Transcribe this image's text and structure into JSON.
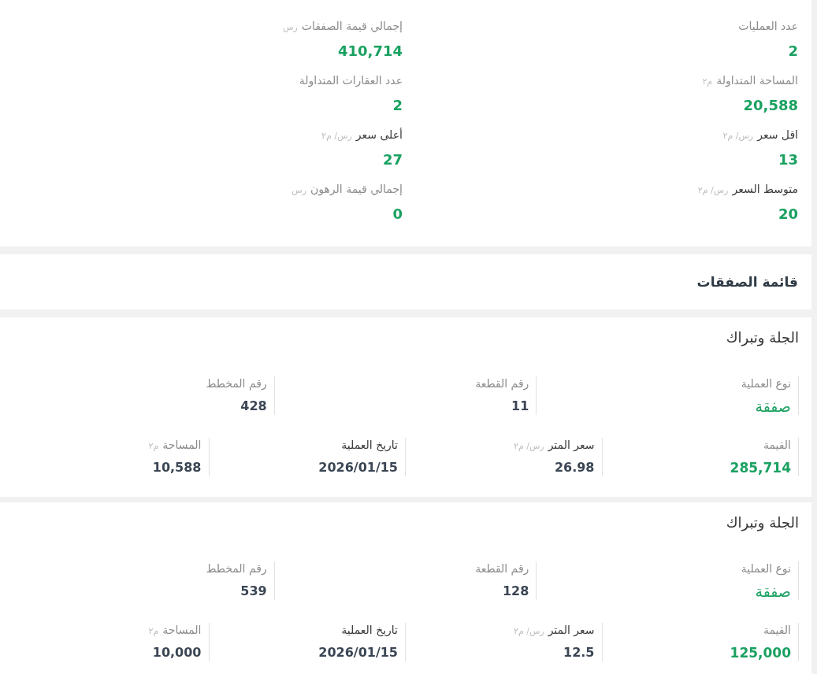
{
  "summary": {
    "stats": [
      {
        "label": "عدد العمليات",
        "value": "2",
        "strong": false
      },
      {
        "label": "إجمالي قيمة الصفقات",
        "unit": "رس",
        "value": "410,714",
        "strong": false
      },
      {
        "label": "المساحة المتداولة",
        "unit": "م٢",
        "value": "20,588",
        "strong": false
      },
      {
        "label": "عدد العقارات المتداولة",
        "value": "2",
        "strong": false
      },
      {
        "label": "اقل سعر",
        "unit": "رس/ م٢",
        "value": "13",
        "strong": true
      },
      {
        "label": "أعلى سعر",
        "unit": "رس/ م٢",
        "value": "27",
        "strong": true
      },
      {
        "label": "متوسط السعر",
        "unit": "رس/ م٢",
        "value": "20",
        "strong": true
      },
      {
        "label": "إجمالي قيمة الرهون",
        "unit": "رس",
        "value": "0",
        "strong": false
      }
    ]
  },
  "deals_list": {
    "title": "قائمة الصفقات",
    "deals": [
      {
        "title": "الجلة وتبراك",
        "rows": [
          {
            "fields": [
              {
                "label": "نوع العملية",
                "value": "صفقة",
                "kind": "type",
                "strong": false
              },
              {
                "label": "رقم القطعة",
                "value": "11",
                "kind": "number",
                "strong": false
              },
              {
                "label": "رقم المخطط",
                "value": "428",
                "kind": "number",
                "strong": false
              }
            ]
          },
          {
            "fields": [
              {
                "label": "القيمة",
                "value": "285,714",
                "kind": "amount",
                "strong": false
              },
              {
                "label": "سعر المتر",
                "unit": "رس/ م٢",
                "value": "26.98",
                "kind": "number",
                "strong": true
              },
              {
                "label": "تاريخ العملية",
                "value": "2026/01/15",
                "kind": "number",
                "strong": true
              },
              {
                "label": "المساحة",
                "unit": "م٢",
                "value": "10,588",
                "kind": "number",
                "strong": false
              }
            ]
          }
        ]
      },
      {
        "title": "الجلة وتبراك",
        "rows": [
          {
            "fields": [
              {
                "label": "نوع العملية",
                "value": "صفقة",
                "kind": "type",
                "strong": false
              },
              {
                "label": "رقم القطعة",
                "value": "128",
                "kind": "number",
                "strong": false
              },
              {
                "label": "رقم المخطط",
                "value": "539",
                "kind": "number",
                "strong": false
              }
            ]
          },
          {
            "fields": [
              {
                "label": "القيمة",
                "value": "125,000",
                "kind": "amount",
                "strong": false
              },
              {
                "label": "سعر المتر",
                "unit": "رس/ م٢",
                "value": "12.5",
                "kind": "number",
                "strong": true
              },
              {
                "label": "تاريخ العملية",
                "value": "2026/01/15",
                "kind": "number",
                "strong": true
              },
              {
                "label": "المساحة",
                "unit": "م٢",
                "value": "10,000",
                "kind": "number",
                "strong": false
              }
            ]
          }
        ]
      }
    ]
  }
}
